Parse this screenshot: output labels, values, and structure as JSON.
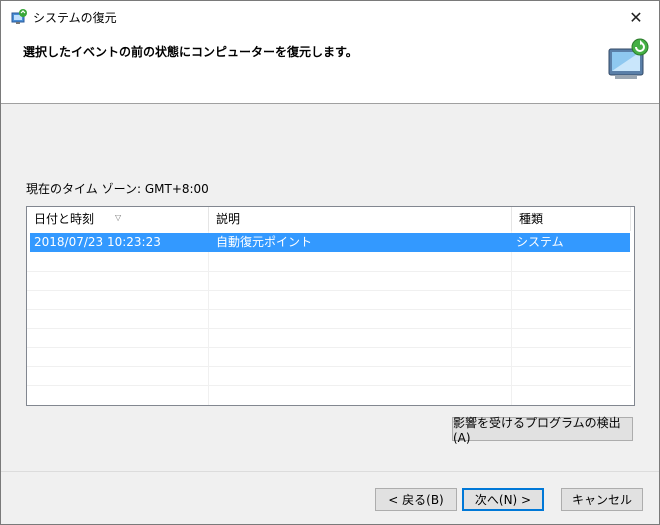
{
  "window": {
    "title": "システムの復元",
    "header_text": "選択したイベントの前の状態にコンピューターを復元します。"
  },
  "timezone_label": "現在のタイム ゾーン: GMT+8:00",
  "list": {
    "columns": [
      "日付と時刻",
      "説明",
      "種類"
    ],
    "rows": [
      {
        "datetime": "2018/07/23 10:23:23",
        "description": "自動復元ポイント",
        "type": "システム",
        "selected": true
      }
    ]
  },
  "buttons": {
    "scan": "影響を受けるプログラムの検出(A)",
    "back": "< 戻る(B)",
    "next": "次へ(N) >",
    "cancel": "キャンセル"
  },
  "colors": {
    "selection": "#3399ff",
    "default_button_border": "#0078d7"
  },
  "icons": {
    "title": "system-restore-icon",
    "header": "system-restore-graphic-icon",
    "close": "close-icon",
    "sort": "sort-down-icon"
  }
}
